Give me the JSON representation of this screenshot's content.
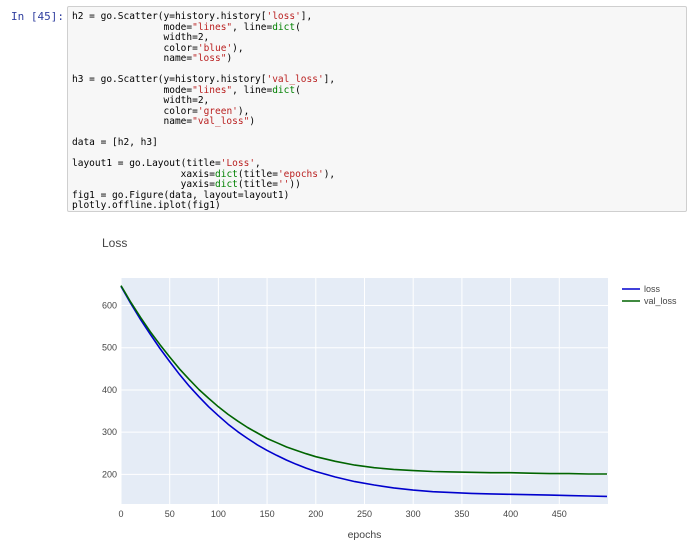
{
  "cell": {
    "prompt": "In [45]:",
    "code_lines": [
      [
        {
          "t": "h2 = go.Scatter(y=history.history["
        },
        {
          "t": "'loss'",
          "c": "s"
        },
        {
          "t": "],"
        }
      ],
      [
        {
          "t": "                mode="
        },
        {
          "t": "\"lines\"",
          "c": "s"
        },
        {
          "t": ", line="
        },
        {
          "t": "dict",
          "c": "b"
        },
        {
          "t": "("
        }
      ],
      [
        {
          "t": "                width=2,"
        }
      ],
      [
        {
          "t": "                color="
        },
        {
          "t": "'blue'",
          "c": "s"
        },
        {
          "t": "),"
        }
      ],
      [
        {
          "t": "                name="
        },
        {
          "t": "\"loss\"",
          "c": "s"
        },
        {
          "t": ")"
        }
      ],
      [
        {
          "t": ""
        }
      ],
      [
        {
          "t": "h3 = go.Scatter(y=history.history["
        },
        {
          "t": "'val_loss'",
          "c": "s"
        },
        {
          "t": "],"
        }
      ],
      [
        {
          "t": "                mode="
        },
        {
          "t": "\"lines\"",
          "c": "s"
        },
        {
          "t": ", line="
        },
        {
          "t": "dict",
          "c": "b"
        },
        {
          "t": "("
        }
      ],
      [
        {
          "t": "                width=2,"
        }
      ],
      [
        {
          "t": "                color="
        },
        {
          "t": "'green'",
          "c": "s"
        },
        {
          "t": "),"
        }
      ],
      [
        {
          "t": "                name="
        },
        {
          "t": "\"val_loss\"",
          "c": "s"
        },
        {
          "t": ")"
        }
      ],
      [
        {
          "t": ""
        }
      ],
      [
        {
          "t": "data = [h2, h3]"
        }
      ],
      [
        {
          "t": ""
        }
      ],
      [
        {
          "t": "layout1 = go.Layout(title="
        },
        {
          "t": "'Loss'",
          "c": "s"
        },
        {
          "t": ","
        }
      ],
      [
        {
          "t": "                   xaxis="
        },
        {
          "t": "dict",
          "c": "b"
        },
        {
          "t": "(title="
        },
        {
          "t": "'epochs'",
          "c": "s"
        },
        {
          "t": "),"
        }
      ],
      [
        {
          "t": "                   yaxis="
        },
        {
          "t": "dict",
          "c": "b"
        },
        {
          "t": "(title="
        },
        {
          "t": "''",
          "c": "s"
        },
        {
          "t": "))"
        }
      ],
      [
        {
          "t": "fig1 = go.Figure(data, layout=layout1)"
        }
      ],
      [
        {
          "t": "plotly.offline.iplot(fig1)"
        }
      ]
    ]
  },
  "colors": {
    "plot_bg": "#e5ecf6",
    "grid": "#ffffff",
    "loss": "#0000cd",
    "val_loss": "#006400"
  },
  "chart_data": {
    "type": "line",
    "title": "Loss",
    "xlabel": "epochs",
    "ylabel": "",
    "xlim": [
      0,
      500
    ],
    "ylim": [
      130,
      665
    ],
    "x_ticks": [
      0,
      50,
      100,
      150,
      200,
      250,
      300,
      350,
      400,
      450
    ],
    "y_ticks": [
      200,
      300,
      400,
      500,
      600
    ],
    "grid": true,
    "legend_position": "top-right",
    "series": [
      {
        "name": "loss",
        "color": "blue",
        "x": [
          0,
          10,
          20,
          30,
          40,
          50,
          60,
          70,
          80,
          90,
          100,
          110,
          120,
          130,
          140,
          150,
          160,
          170,
          180,
          190,
          200,
          220,
          240,
          260,
          280,
          300,
          320,
          340,
          360,
          380,
          400,
          420,
          440,
          460,
          480,
          499
        ],
        "y": [
          645,
          605,
          567,
          532,
          498,
          467,
          437,
          409,
          384,
          360,
          339,
          319,
          301,
          285,
          270,
          257,
          245,
          234,
          224,
          215,
          207,
          194,
          183,
          175,
          168,
          163,
          159,
          157,
          155,
          154,
          153,
          152,
          151,
          150,
          149,
          148
        ]
      },
      {
        "name": "val_loss",
        "color": "green",
        "x": [
          0,
          10,
          20,
          30,
          40,
          50,
          60,
          70,
          80,
          90,
          100,
          110,
          120,
          130,
          140,
          150,
          160,
          170,
          180,
          190,
          200,
          220,
          240,
          260,
          280,
          300,
          320,
          340,
          360,
          380,
          400,
          420,
          440,
          460,
          480,
          499
        ],
        "y": [
          647,
          608,
          572,
          538,
          507,
          478,
          450,
          425,
          401,
          380,
          360,
          342,
          326,
          311,
          298,
          285,
          275,
          265,
          257,
          249,
          242,
          231,
          222,
          216,
          212,
          209,
          207,
          206,
          205,
          204,
          204,
          203,
          202,
          202,
          201,
          201
        ]
      }
    ]
  }
}
